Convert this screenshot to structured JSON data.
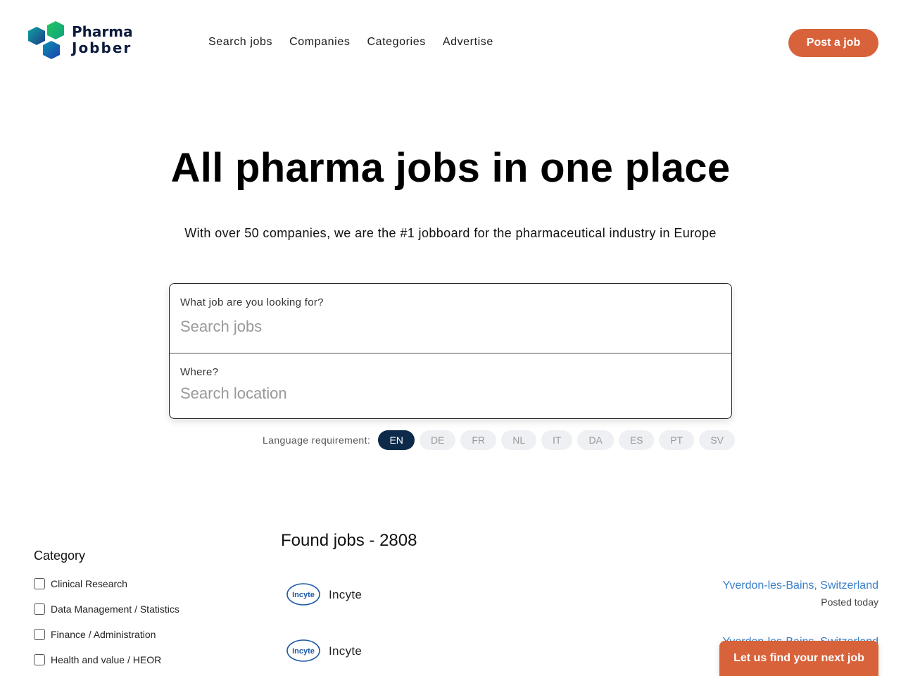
{
  "brand": {
    "line1": "Pharma",
    "line2": "Jobber"
  },
  "nav": {
    "items": [
      "Search jobs",
      "Companies",
      "Categories",
      "Advertise"
    ],
    "post_job": "Post a job"
  },
  "hero": {
    "title": "All pharma jobs in one place",
    "subtitle": "With over 50 companies, we are the #1 jobboard for the pharmaceutical industry in Europe"
  },
  "search": {
    "job_label": "What job are you looking for?",
    "job_placeholder": "Search jobs",
    "job_value": "",
    "location_label": "Where?",
    "location_placeholder": "Search location",
    "location_value": ""
  },
  "language": {
    "label": "Language requirement:",
    "options": [
      "EN",
      "DE",
      "FR",
      "NL",
      "IT",
      "DA",
      "ES",
      "PT",
      "SV"
    ],
    "selected": "EN"
  },
  "filters": {
    "category_title": "Category",
    "categories": [
      "Clinical Research",
      "Data Management / Statistics",
      "Finance / Administration",
      "Health and value / HEOR"
    ]
  },
  "results": {
    "found_label": "Found jobs - 2808",
    "jobs": [
      {
        "company": "Incyte",
        "location": "Yverdon-les-Bains, Switzerland",
        "posted": "Posted today"
      },
      {
        "company": "Incyte",
        "location": "Yverdon-les-Bains, Switzerland",
        "posted": ""
      }
    ]
  },
  "cta": {
    "find_job": "Let us find your next job"
  },
  "colors": {
    "accent": "#d8623a",
    "navy": "#0d2a4a",
    "link": "#3a7fc6"
  }
}
